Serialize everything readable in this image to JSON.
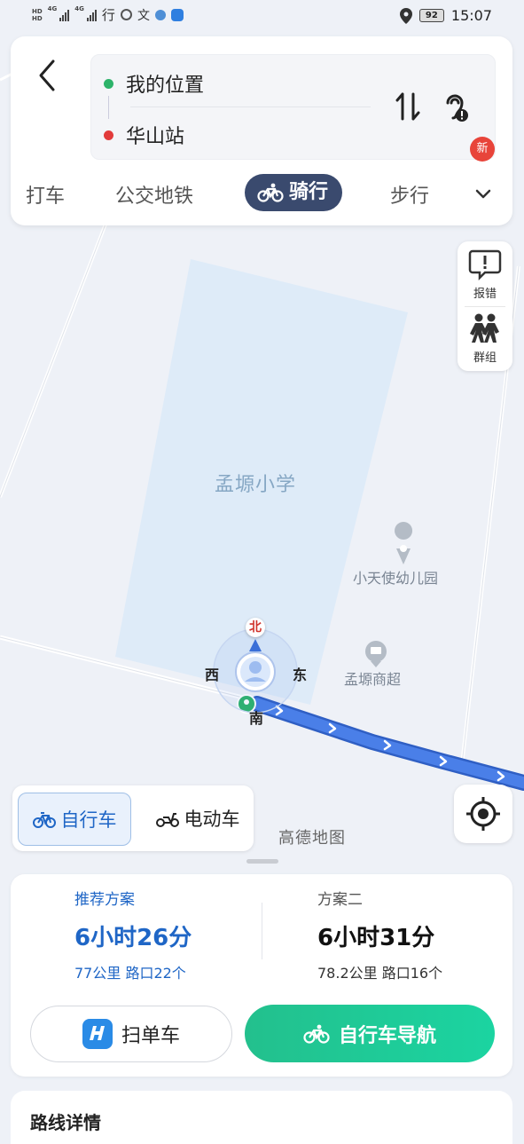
{
  "status_bar": {
    "hd1": "HD",
    "hd2": "HD",
    "net1": "4G",
    "net2": "4G",
    "carrier_text": "行",
    "battery": "92",
    "time": "15:07"
  },
  "top": {
    "origin": "我的位置",
    "destination": "华山站",
    "modes": [
      {
        "label": "打车"
      },
      {
        "label": "公交地铁"
      },
      {
        "label": "骑行"
      },
      {
        "label": "步行"
      }
    ],
    "new_badge": "新"
  },
  "map": {
    "side_tools": [
      {
        "label": "报错"
      },
      {
        "label": "群组"
      }
    ],
    "school": "孟塬小学",
    "poi1": "小天使幼儿园",
    "poi2": "孟塬商超",
    "compass": {
      "n": "北",
      "s": "南",
      "w": "西",
      "e": "东"
    },
    "vehicle_toggle": [
      {
        "label": "自行车"
      },
      {
        "label": "电动车"
      }
    ],
    "brand": "高德地图"
  },
  "plans": {
    "a": {
      "tag": "推荐方案",
      "time": "6小时26分",
      "meta": "77公里  路口22个"
    },
    "b": {
      "tag": "方案二",
      "time": "6小时31分",
      "meta": "78.2公里  路口16个"
    },
    "scan_label": "扫单车",
    "nav_label": "自行车导航"
  },
  "detail": {
    "title": "路线详情"
  },
  "colors": {
    "accent": "#1f66c6",
    "nav_green": "#1fc995",
    "origin_dot": "#2db36a",
    "dest_dot": "#e23b3b",
    "route": "#3c6fd8"
  }
}
